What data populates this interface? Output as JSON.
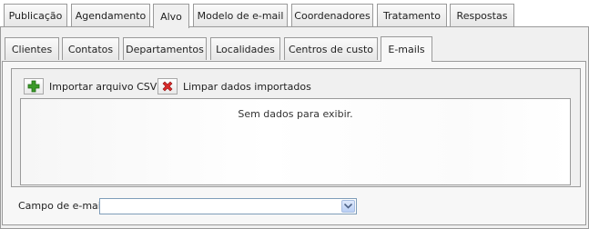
{
  "top_tabs": [
    {
      "label": "Publicação"
    },
    {
      "label": "Agendamento"
    },
    {
      "label": "Alvo",
      "active": true
    },
    {
      "label": "Modelo de e-mail"
    },
    {
      "label": "Coordenadores"
    },
    {
      "label": "Tratamento"
    },
    {
      "label": "Respostas"
    }
  ],
  "sub_tabs": [
    {
      "label": "Clientes"
    },
    {
      "label": "Contatos"
    },
    {
      "label": "Departamentos"
    },
    {
      "label": "Localidades"
    },
    {
      "label": "Centros de custo"
    },
    {
      "label": "E-mails",
      "active": true
    }
  ],
  "toolbar": {
    "import_label": "Importar arquivo CSV",
    "import_icon": "plus-icon",
    "clear_label": "Limpar dados importados",
    "clear_icon": "close-icon"
  },
  "grid": {
    "empty_text": "Sem dados para exibir."
  },
  "email_field": {
    "label": "Campo de e-mail",
    "value": ""
  },
  "colors": {
    "add_green": "#3c9a2a",
    "delete_red": "#d92b2b",
    "border": "#9a9a9a"
  }
}
